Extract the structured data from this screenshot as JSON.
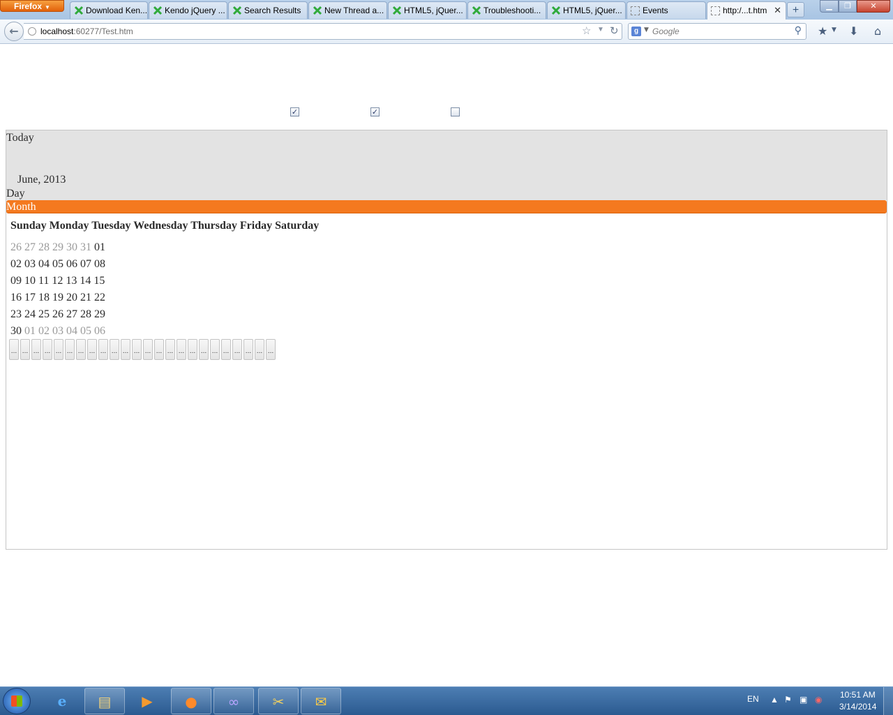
{
  "browser": {
    "menu_button": "Firefox",
    "tabs": [
      {
        "title": "Download Ken..."
      },
      {
        "title": "Kendo jQuery ..."
      },
      {
        "title": "Search Results"
      },
      {
        "title": "New Thread a..."
      },
      {
        "title": "HTML5, jQuer..."
      },
      {
        "title": "Troubleshooti..."
      },
      {
        "title": "HTML5, jQuer..."
      },
      {
        "title": "Events"
      },
      {
        "title": "http:/...t.htm"
      }
    ],
    "new_tab": "+",
    "url_host": "localhost",
    "url_rest": ":60277/Test.htm",
    "search_placeholder": "Google"
  },
  "page": {
    "checkboxes": [
      true,
      true,
      false
    ],
    "scheduler": {
      "today_label": "Today",
      "range_title": "June, 2013",
      "day_label": "Day",
      "month_label": "Month",
      "weekday_header": "Sunday Monday Tuesday Wednesday Thursday Friday Saturday",
      "weeks": [
        [
          {
            "t": "26",
            "o": true
          },
          {
            "t": "27",
            "o": true
          },
          {
            "t": "28",
            "o": true
          },
          {
            "t": "29",
            "o": true
          },
          {
            "t": "30",
            "o": true
          },
          {
            "t": "31",
            "o": true
          },
          {
            "t": "01",
            "o": false
          }
        ],
        [
          {
            "t": "02",
            "o": false
          },
          {
            "t": "03",
            "o": false
          },
          {
            "t": "04",
            "o": false
          },
          {
            "t": "05",
            "o": false
          },
          {
            "t": "06",
            "o": false
          },
          {
            "t": "07",
            "o": false
          },
          {
            "t": "08",
            "o": false
          }
        ],
        [
          {
            "t": "09",
            "o": false
          },
          {
            "t": "10",
            "o": false
          },
          {
            "t": "11",
            "o": false
          },
          {
            "t": "12",
            "o": false
          },
          {
            "t": "13",
            "o": false
          },
          {
            "t": "14",
            "o": false
          },
          {
            "t": "15",
            "o": false
          }
        ],
        [
          {
            "t": "16",
            "o": false
          },
          {
            "t": "17",
            "o": false
          },
          {
            "t": "18",
            "o": false
          },
          {
            "t": "19",
            "o": false
          },
          {
            "t": "20",
            "o": false
          },
          {
            "t": "21",
            "o": false
          },
          {
            "t": "22",
            "o": false
          }
        ],
        [
          {
            "t": "23",
            "o": false
          },
          {
            "t": "24",
            "o": false
          },
          {
            "t": "25",
            "o": false
          },
          {
            "t": "26",
            "o": false
          },
          {
            "t": "27",
            "o": false
          },
          {
            "t": "28",
            "o": false
          },
          {
            "t": "29",
            "o": false
          }
        ],
        [
          {
            "t": "30",
            "o": false
          },
          {
            "t": "01",
            "o": true
          },
          {
            "t": "02",
            "o": true
          },
          {
            "t": "03",
            "o": true
          },
          {
            "t": "04",
            "o": true
          },
          {
            "t": "05",
            "o": true
          },
          {
            "t": "06",
            "o": true
          }
        ]
      ],
      "slot_label": "...",
      "slot_count": 24
    }
  },
  "taskbar": {
    "language": "EN",
    "time": "10:51 AM",
    "date": "3/14/2014"
  }
}
